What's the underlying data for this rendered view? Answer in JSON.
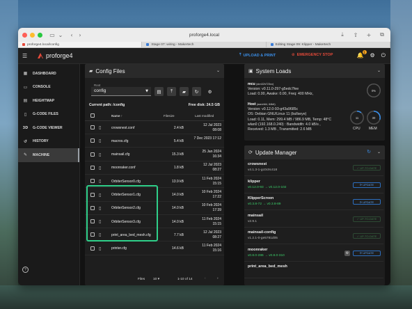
{
  "browser": {
    "url": "proforge4.local",
    "tabs": [
      {
        "label": "proforge4.local/config",
        "active": true
      },
      {
        "label": "Stage 07: wiring - Makertech",
        "active": false
      },
      {
        "label": "Editing Stage 09: Klipper - Makertech",
        "active": false
      }
    ]
  },
  "app": {
    "brand": "proforge4",
    "upload_label": "UPLOAD & PRINT",
    "estop_label": "EMERGENCY STOP",
    "notif_count": "1",
    "colors": {
      "accent": "#3b8fe8",
      "estop": "#e44a3a",
      "highlight": "#2fd08a",
      "ok": "#3ccf6a"
    }
  },
  "sidebar": {
    "items": [
      {
        "icon": "dashboard-icon",
        "label": "DASHBOARD"
      },
      {
        "icon": "console-icon",
        "label": "CONSOLE"
      },
      {
        "icon": "heightmap-icon",
        "label": "HEIGHTMAP"
      },
      {
        "icon": "gcode-files-icon",
        "label": "G-CODE FILES"
      },
      {
        "icon": "3d-icon",
        "label": "G-CODE VIEWER"
      },
      {
        "icon": "history-icon",
        "label": "HISTORY"
      },
      {
        "icon": "wrench-icon",
        "label": "MACHINE"
      }
    ]
  },
  "config": {
    "title": "Config Files",
    "root_label": "Root",
    "root_value": "config",
    "current_path_label": "Current path: /config",
    "free_disk_label": "Free disk: 24.5 GB",
    "col_name": "Name",
    "col_size": "Filesize",
    "col_modified": "Last modified",
    "files": [
      {
        "name": "crowsnest.conf",
        "size": "2.4 kB",
        "date": "12 Jul 2023",
        "time": "08:08"
      },
      {
        "name": "macros.cfg",
        "size": "5.4 kB",
        "date": "7 Dec 2023 17:12",
        "time": ""
      },
      {
        "name": "mainsail.cfg",
        "size": "15.3 kB",
        "date": "25 Jan 2024",
        "time": "16:34"
      },
      {
        "name": "moonraker.conf",
        "size": "1.8 kB",
        "date": "12 Jul 2023",
        "time": "08:27"
      },
      {
        "name": "OrbiterSensor0.cfg",
        "size": "13.9 kB",
        "date": "11 Feb 2024",
        "time": "15:15"
      },
      {
        "name": "OrbiterSensor1.cfg",
        "size": "14.0 kB",
        "date": "10 Feb 2024",
        "time": "17:22"
      },
      {
        "name": "OrbiterSensor2.cfg",
        "size": "14.0 kB",
        "date": "10 Feb 2024",
        "time": "17:39"
      },
      {
        "name": "OrbiterSensor3.cfg",
        "size": "14.0 kB",
        "date": "11 Feb 2024",
        "time": "15:15"
      },
      {
        "name": "print_area_bed_mesh.cfg",
        "size": "7.7 kB",
        "date": "12 Jul 2023",
        "time": "08:27"
      },
      {
        "name": "printer.cfg",
        "size": "14.6 kB",
        "date": "11 Feb 2024",
        "time": "15:16"
      }
    ],
    "pager_label": "Files",
    "pager_per_page": "10",
    "pager_range": "1-10 of 14"
  },
  "sysloads": {
    "title": "System Loads",
    "mcu_name": "mcu",
    "mcu_chip": "(stm32h723xx)",
    "mcu_version": "Version: v0.11.0-297-g5edc7fee",
    "mcu_load": "Load: 0.00, Awake: 0.00, Freq: 400 MHz,",
    "mcu_gauge": "0%",
    "host_name": "Host",
    "host_arch": "(aarch64, 64bit)",
    "host_version": "Version: v0.12.0-93-g43a9685c",
    "host_os": "OS: Debian GNU/Linux 11 (bullseye)",
    "host_load": "Load: 0.11, Mem: 299.4 MB / 986.9 MB, Temp: 48°C",
    "host_net": "wlan0 (192.168.0.240) : Bandwidth: 4.0 kB/s ,",
    "host_recv": "Received: 1.3 MB , Transmitted: 2.6 MB",
    "cpu_value": "11",
    "cpu_label": "CPU",
    "cpu_fraction": 0.11,
    "mem_value": "30",
    "mem_label": "MEM",
    "mem_fraction": 0.3
  },
  "updates": {
    "title": "Update Manager",
    "items": [
      {
        "name": "crowsnest",
        "version": "v4.1.3-1-gc0c9c418",
        "green": false,
        "button": "UP-TO-DATE",
        "kind": "dis"
      },
      {
        "name": "klipper",
        "version": "v0.12.0-93 → v0.12.0-102",
        "green": true,
        "button": "UPDATE",
        "kind": "upd"
      },
      {
        "name": "KlipperScreen",
        "version": "v0.3.8-72 → v0.3.8-89",
        "green": true,
        "button": "UPDATE",
        "kind": "upd"
      },
      {
        "name": "mainsail",
        "version": "v2.9.1",
        "green": false,
        "button": "UP-TO-DATE",
        "kind": "dis"
      },
      {
        "name": "mainsail-config",
        "version": "v1.2.1-0-ge5781d05",
        "green": false,
        "button": "UP-TO-DATE",
        "kind": "dis"
      },
      {
        "name": "moonraker",
        "version": "v0.8.0-286 → v0.8.0-310",
        "green": true,
        "button": "UPDATE",
        "kind": "upd"
      },
      {
        "name": "print_area_bed_mesh",
        "version": "",
        "green": false,
        "button": "",
        "kind": "dis"
      }
    ]
  }
}
